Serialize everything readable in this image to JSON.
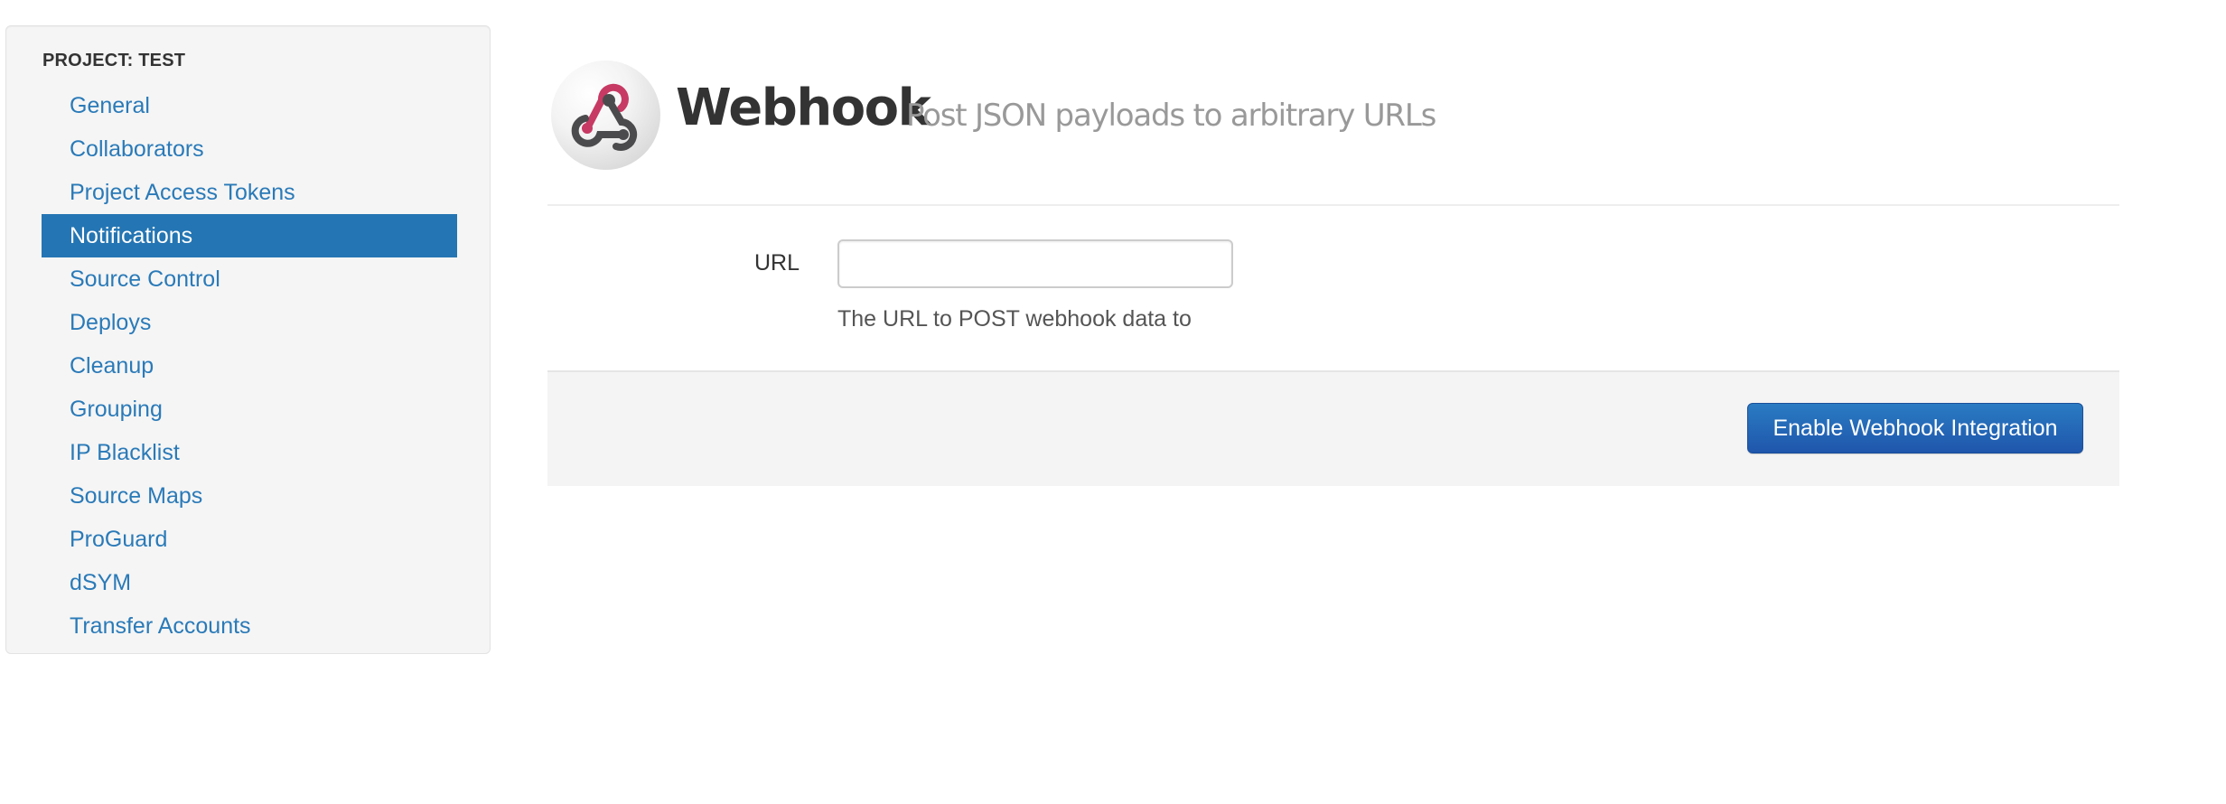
{
  "sidebar": {
    "header": "PROJECT: TEST",
    "active_index": 3,
    "items": [
      {
        "label": "General"
      },
      {
        "label": "Collaborators"
      },
      {
        "label": "Project Access Tokens"
      },
      {
        "label": "Notifications"
      },
      {
        "label": "Source Control"
      },
      {
        "label": "Deploys"
      },
      {
        "label": "Cleanup"
      },
      {
        "label": "Grouping"
      },
      {
        "label": "IP Blacklist"
      },
      {
        "label": "Source Maps"
      },
      {
        "label": "ProGuard"
      },
      {
        "label": "dSYM"
      },
      {
        "label": "Transfer Accounts"
      }
    ]
  },
  "header": {
    "logo_icon": "webhook-icon",
    "title": "Webhook",
    "subtitle": "Post JSON payloads to arbitrary URLs"
  },
  "form": {
    "url_label": "URL",
    "url_value": "",
    "url_placeholder": "",
    "url_help": "The URL to POST webhook data to"
  },
  "footer": {
    "enable_button_label": "Enable Webhook Integration"
  },
  "colors": {
    "link": "#2a7ab8",
    "active_bg": "#2475b3",
    "button_top": "#2a7bc2",
    "button_bottom": "#1f56ac",
    "logo_pink": "#c73a63",
    "logo_dark": "#4b4b4d"
  }
}
